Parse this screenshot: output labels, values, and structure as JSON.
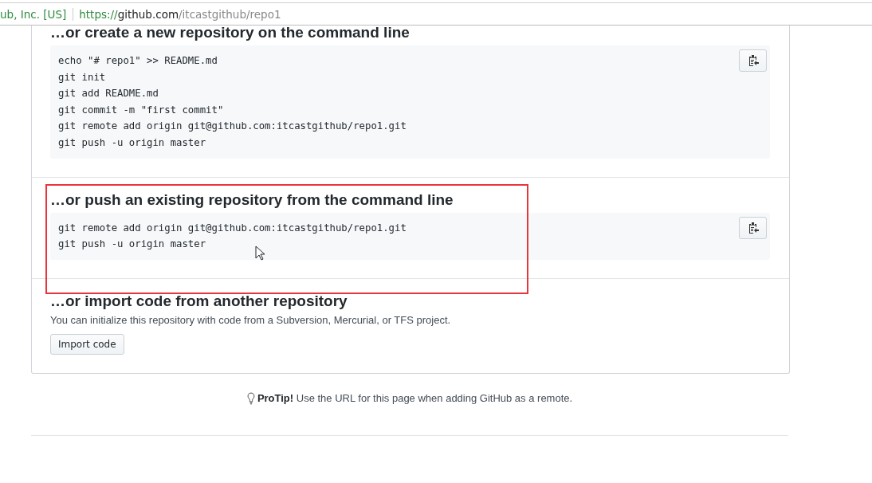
{
  "address_bar": {
    "identity": "ub, Inc. [US]",
    "url_scheme": "https://",
    "url_host": "github.com",
    "url_path": "/itcastgithub/repo1"
  },
  "sections": [
    {
      "kind": "code",
      "title": "…or create a new repository on the command line",
      "highlighted": false,
      "lines": [
        "echo \"# repo1\" >> README.md",
        "git init",
        "git add README.md",
        "git commit -m \"first commit\"",
        "git remote add origin git@github.com:itcastgithub/repo1.git",
        "git push -u origin master"
      ]
    },
    {
      "kind": "code",
      "title": "…or push an existing repository from the command line",
      "highlighted": true,
      "lines": [
        "git remote add origin git@github.com:itcastgithub/repo1.git",
        "git push -u origin master"
      ]
    },
    {
      "kind": "import",
      "title": "…or import code from another repository",
      "highlighted": false,
      "description": "You can initialize this repository with code from a Subversion, Mercurial, or TFS project.",
      "button": "Import code"
    }
  ],
  "protip": "**ProTip!** Use the URL for this page when adding GitHub as a remote."
}
